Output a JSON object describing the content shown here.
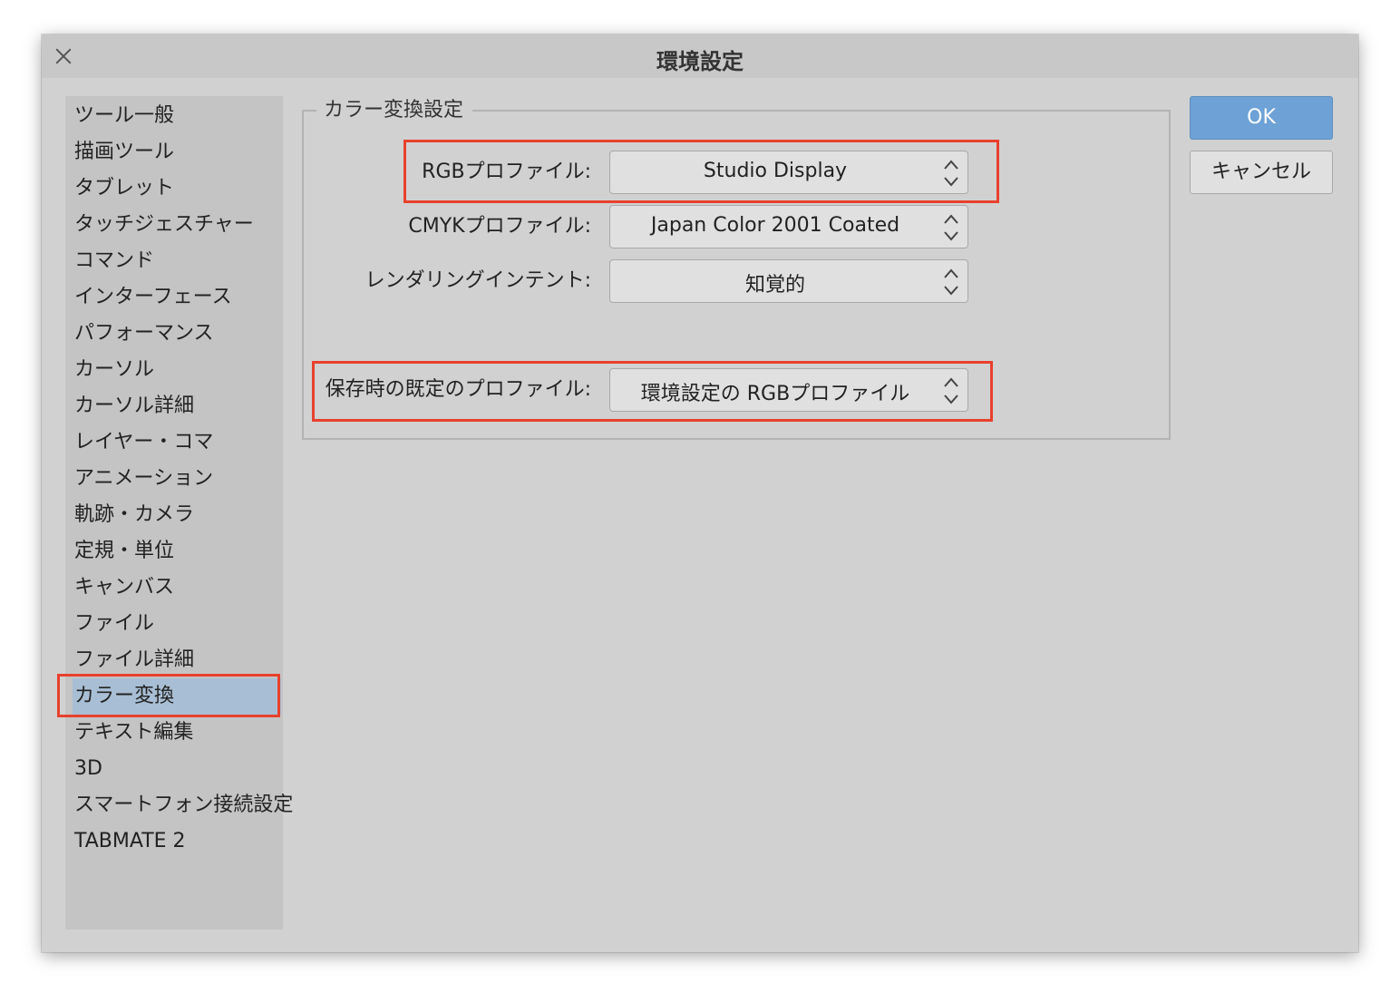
{
  "window": {
    "title": "環境設定"
  },
  "sidebar": {
    "items": [
      {
        "label": "ツール一般"
      },
      {
        "label": "描画ツール"
      },
      {
        "label": "タブレット"
      },
      {
        "label": "タッチジェスチャー"
      },
      {
        "label": "コマンド"
      },
      {
        "label": "インターフェース"
      },
      {
        "label": "パフォーマンス"
      },
      {
        "label": "カーソル"
      },
      {
        "label": "カーソル詳細"
      },
      {
        "label": "レイヤー・コマ"
      },
      {
        "label": "アニメーション"
      },
      {
        "label": "軌跡・カメラ"
      },
      {
        "label": "定規・単位"
      },
      {
        "label": "キャンバス"
      },
      {
        "label": "ファイル"
      },
      {
        "label": "ファイル詳細"
      },
      {
        "label": "カラー変換",
        "selected": true
      },
      {
        "label": "テキスト編集"
      },
      {
        "label": "3D"
      },
      {
        "label": "スマートフォン接続設定"
      },
      {
        "label": "TABMATE 2"
      }
    ]
  },
  "color_conversion": {
    "group_title": "カラー変換設定",
    "rgb_profile": {
      "label": "RGBプロファイル:",
      "value": "Studio Display"
    },
    "cmyk_profile": {
      "label": "CMYKプロファイル:",
      "value": "Japan Color 2001 Coated"
    },
    "rendering_intent": {
      "label": "レンダリングインテント:",
      "value": "知覚的"
    },
    "default_save_profile": {
      "label": "保存時の既定のプロファイル:",
      "value": "環境設定の RGBプロファイル"
    }
  },
  "buttons": {
    "ok": "OK",
    "cancel": "キャンセル"
  },
  "colors": {
    "highlight_border": "#e8412d",
    "selected_item_bg": "#a8bed4",
    "ok_button_bg": "#6ea2d6",
    "dialog_bg": "#d1d1d1"
  },
  "icons": {
    "close": "close-icon",
    "stepper": "chevron-up-down-icon"
  }
}
